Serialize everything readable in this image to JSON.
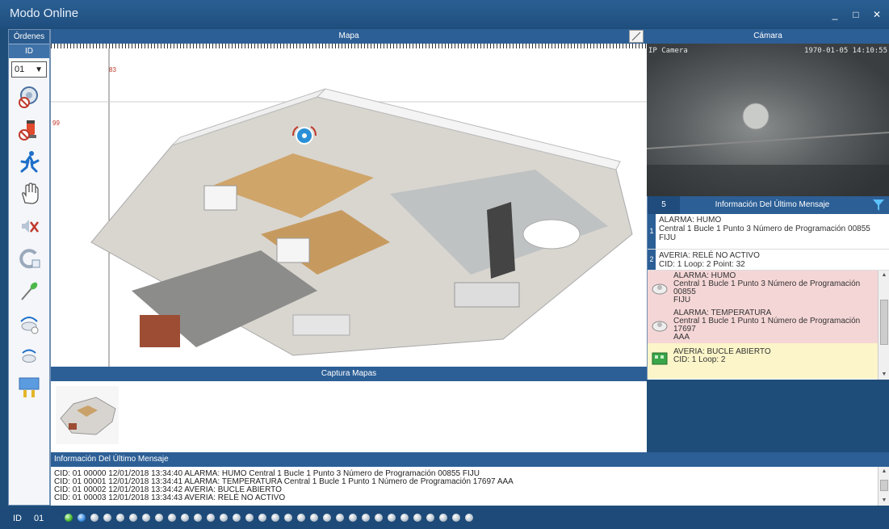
{
  "window": {
    "title": "Modo Online"
  },
  "window_controls": {
    "minimize": "_",
    "maximize": "□",
    "close": "✕"
  },
  "left_toolbar": {
    "header": "Órdenes",
    "id_label": "ID",
    "selected_id": "01",
    "tools": [
      "smoke-detector-disabled-icon",
      "siren-disabled-icon",
      "running-person-icon",
      "hand-icon",
      "mute-icon",
      "reset-icon",
      "probe-icon",
      "sensor-scan-icon",
      "sensor-icon",
      "panel-icon"
    ]
  },
  "map_panel": {
    "header": "Mapa",
    "ruler_x_mark": "83",
    "ruler_y_mark": "99"
  },
  "camera_panel": {
    "header": "Cámara",
    "overlay_left": "IP Camera",
    "overlay_right": "1970-01-05 14:10:55"
  },
  "info_panel": {
    "count": "5",
    "title": "Información Del Último Mensaje",
    "messages": [
      {
        "index": "1",
        "lines": [
          "ALARMA: HUMO",
          "Central 1 Bucle 1 Punto 3 Número de Programación 00855",
          "FIJU"
        ]
      },
      {
        "index": "2",
        "lines": [
          "AVERIA: RELÉ NO ACTIVO",
          "CID: 1 Loop: 2 Point: 32"
        ]
      }
    ],
    "events": [
      {
        "type": "alarm",
        "lines": [
          "ALARMA: HUMO",
          "Central 1 Bucle 1 Punto 3 Número de Programación",
          "00855",
          "FIJU"
        ]
      },
      {
        "type": "alarm",
        "lines": [
          "ALARMA: TEMPERATURA",
          "Central 1 Bucle 1 Punto 1 Número de Programación",
          "17697",
          "AAA"
        ]
      },
      {
        "type": "fault",
        "lines": [
          "AVERIA: BUCLE ABIERTO",
          "CID: 1 Loop: 2"
        ]
      }
    ]
  },
  "capture_panel": {
    "header": "Captura Mapas"
  },
  "log_panel": {
    "header": "Información Del Último Mensaje",
    "lines": [
      "CID: 01 00000 12/01/2018 13:34:40 ALARMA: HUMO Central 1 Bucle 1 Punto 3 Número de Programación 00855 FIJU",
      "CID: 01 00001 12/01/2018 13:34:41 ALARMA: TEMPERATURA Central 1 Bucle 1 Punto 1 Número de Programación 17697 AAA",
      "CID: 01 00002 12/01/2018 13:34:42 AVERIA: BUCLE ABIERTO",
      "CID: 01 00003 12/01/2018 13:34:43 AVERIA: RELÉ NO ACTIVO"
    ]
  },
  "status_bar": {
    "id_label": "ID",
    "id_value": "01",
    "led_count": 32,
    "led_states": [
      "green",
      "blue"
    ]
  },
  "colors": {
    "accent": "#2c5f96",
    "alarm_bg": "#f5d6d6",
    "fault_bg": "#fbf5c9"
  }
}
